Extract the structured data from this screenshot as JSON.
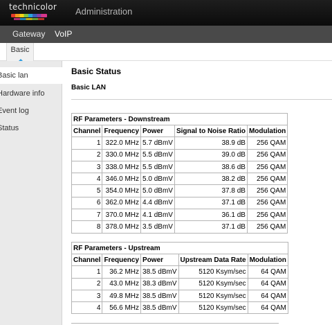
{
  "header": {
    "logo_text": "technicolor",
    "title": "Administration"
  },
  "nav": {
    "items": [
      {
        "label": "Gateway"
      },
      {
        "label": "VoIP"
      }
    ]
  },
  "subtabs": [
    {
      "label": "Basic"
    }
  ],
  "sidebar": {
    "items": [
      {
        "label": "Basic lan"
      },
      {
        "label": "Hardware info"
      },
      {
        "label": "Event log"
      },
      {
        "label": "Status"
      }
    ]
  },
  "main": {
    "title": "Basic Status",
    "section": "Basic LAN",
    "downstream": {
      "caption": "RF Parameters - Downstream",
      "headers": [
        "Channel",
        "Frequency",
        "Power",
        "Signal to Noise Ratio",
        "Modulation"
      ],
      "rows": [
        [
          "1",
          "322.0 MHz",
          "5.7 dBmV",
          "38.9 dB",
          "256 QAM"
        ],
        [
          "2",
          "330.0 MHz",
          "5.5 dBmV",
          "39.0 dB",
          "256 QAM"
        ],
        [
          "3",
          "338.0 MHz",
          "5.5 dBmV",
          "38.6 dB",
          "256 QAM"
        ],
        [
          "4",
          "346.0 MHz",
          "5.0 dBmV",
          "38.2 dB",
          "256 QAM"
        ],
        [
          "5",
          "354.0 MHz",
          "5.0 dBmV",
          "37.8 dB",
          "256 QAM"
        ],
        [
          "6",
          "362.0 MHz",
          "4.4 dBmV",
          "37.1 dB",
          "256 QAM"
        ],
        [
          "7",
          "370.0 MHz",
          "4.1 dBmV",
          "36.1 dB",
          "256 QAM"
        ],
        [
          "8",
          "378.0 MHz",
          "3.5 dBmV",
          "37.1 dB",
          "256 QAM"
        ]
      ]
    },
    "upstream": {
      "caption": "RF Parameters - Upstream",
      "headers": [
        "Channel",
        "Frequency",
        "Power",
        "Upstream Data Rate",
        "Modulation"
      ],
      "rows": [
        [
          "1",
          "36.2 MHz",
          "38.5 dBmV",
          "5120 Ksym/sec",
          "64 QAM"
        ],
        [
          "2",
          "43.0 MHz",
          "38.3 dBmV",
          "5120 Ksym/sec",
          "64 QAM"
        ],
        [
          "3",
          "49.8 MHz",
          "38.5 dBmV",
          "5120 Ksym/sec",
          "64 QAM"
        ],
        [
          "4",
          "56.6 MHz",
          "38.5 dBmV",
          "5120 Ksym/sec",
          "64 QAM"
        ]
      ]
    }
  }
}
